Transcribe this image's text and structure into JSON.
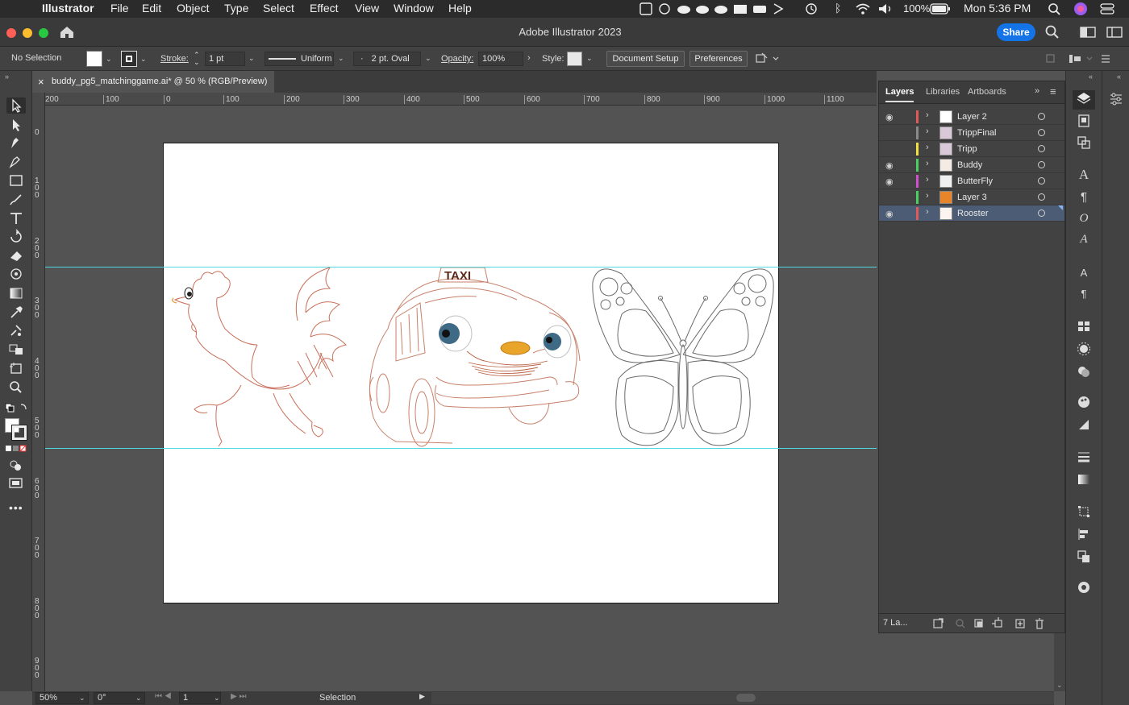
{
  "menubar": {
    "app_name": "Illustrator",
    "items": [
      "File",
      "Edit",
      "Object",
      "Type",
      "Select",
      "Effect",
      "View",
      "Window",
      "Help"
    ],
    "battery": "100%",
    "clock": "Mon 5:36 PM"
  },
  "titlebar": {
    "title": "Adobe Illustrator 2023",
    "share_label": "Share"
  },
  "controlbar": {
    "selection_status": "No Selection",
    "stroke_label": "Stroke:",
    "stroke_value": "1 pt",
    "profile_value": "Uniform",
    "brush_value": "2 pt. Oval",
    "brush_dot": "·",
    "opacity_label": "Opacity:",
    "opacity_value": "100%",
    "style_label": "Style:",
    "document_setup_label": "Document Setup",
    "preferences_label": "Preferences"
  },
  "document_tab": {
    "close_glyph": "×",
    "title": "buddy_pg5_matchinggame.ai* @ 50 % (RGB/Preview)"
  },
  "rulers": {
    "horizontal_ticks": [
      "200",
      "100",
      "0",
      "100",
      "200",
      "300",
      "400",
      "500",
      "600",
      "700",
      "800",
      "900",
      "1000",
      "1100"
    ],
    "vertical_ticks": [
      "0",
      "100",
      "200",
      "300",
      "400",
      "500",
      "600",
      "700",
      "800",
      "900"
    ]
  },
  "artwork": {
    "taxi_sign": "TAXI"
  },
  "statusbar": {
    "zoom": "50%",
    "rotation": "0°",
    "artboard_number": "1",
    "tool_name": "Selection"
  },
  "layers_panel": {
    "tabs": [
      "Layers",
      "Libraries",
      "Artboards"
    ],
    "layers": [
      {
        "name": "Layer 2",
        "color": "#e05a5a",
        "visible": true,
        "selected": false
      },
      {
        "name": "TrippFinal",
        "color": "#8a8a8a",
        "visible": false,
        "selected": false
      },
      {
        "name": "Tripp",
        "color": "#f0e040",
        "visible": false,
        "selected": false
      },
      {
        "name": "Buddy",
        "color": "#4ad060",
        "visible": true,
        "selected": false
      },
      {
        "name": "ButterFly",
        "color": "#d050d0",
        "visible": true,
        "selected": false
      },
      {
        "name": "Layer 3",
        "color": "#4ad060",
        "visible": false,
        "selected": false
      },
      {
        "name": "Rooster",
        "color": "#e05a5a",
        "visible": true,
        "selected": true
      }
    ],
    "footer_count": "7 La...",
    "eye_glyph": "👁",
    "chevron_glyph": "›"
  },
  "colors": {
    "guide": "#4fd8e0",
    "rooster_stroke": "#c8705a",
    "taxi_stroke": "#c8806a",
    "butterfly_stroke": "#6a6a6a",
    "share_button": "#1473e6"
  }
}
